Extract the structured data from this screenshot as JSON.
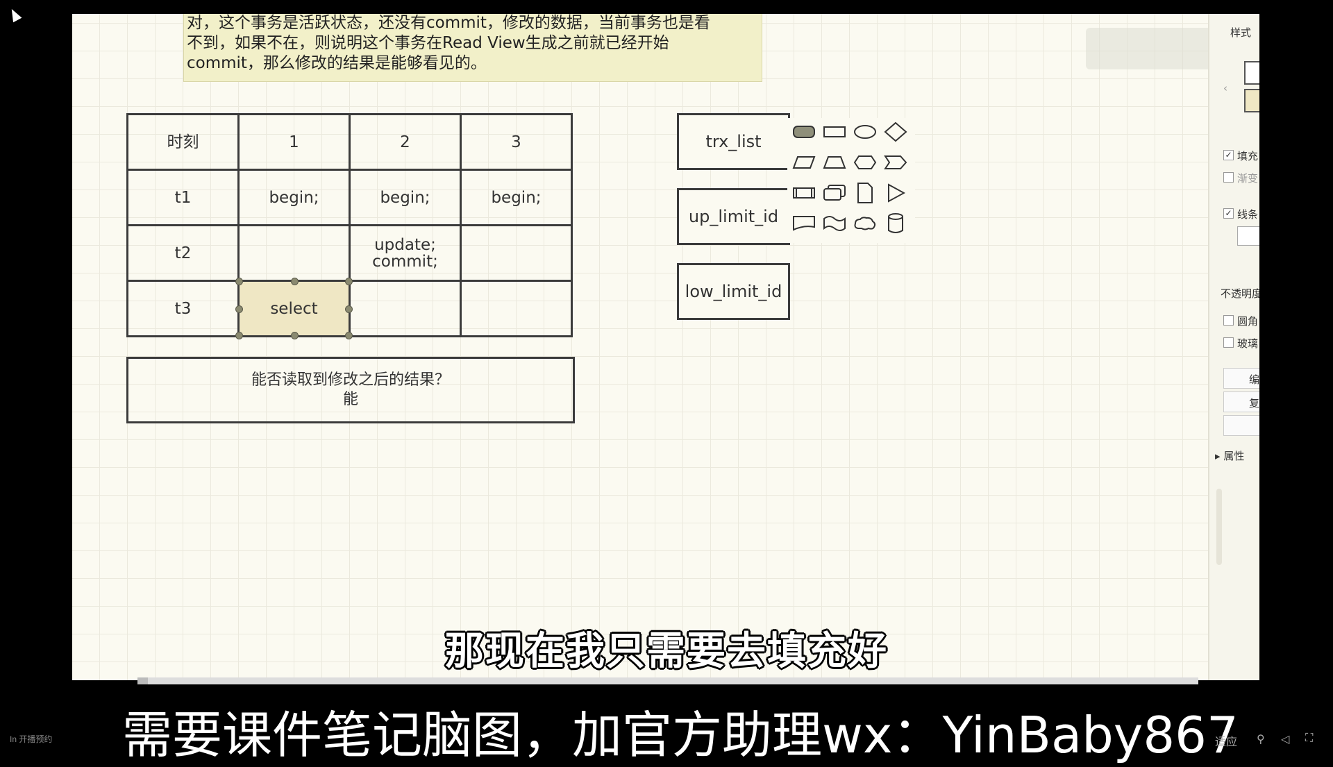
{
  "note": {
    "lines": [
      "对，这个事务是活跃状态，还没有commit，修改的数据，当前事务也是看",
      "不到，如果不在，则说明这个事务在Read View生成之前就已经开始",
      "commit，那么修改的结果是能够看见的。"
    ]
  },
  "table": {
    "header": [
      "时刻",
      "1",
      "2",
      "3"
    ],
    "rows": [
      [
        "t1",
        "begin;",
        "begin;",
        "begin;"
      ],
      [
        "t2",
        "",
        "update;\ncommit;",
        ""
      ],
      [
        "t3",
        "select",
        "",
        ""
      ]
    ]
  },
  "answer": {
    "question": "能否读取到修改之后的结果？",
    "result": "能"
  },
  "readview": {
    "trx_list": "trx_list",
    "up_limit_id": "up_limit_id",
    "low_limit_id": "low_limit_id"
  },
  "palette": {
    "shapes": [
      "rounded-rect-icon",
      "rectangle-icon",
      "ellipse-icon",
      "diamond-icon",
      "parallelogram-icon",
      "trapezoid-icon",
      "hexagon-icon",
      "tag-icon",
      "process-icon",
      "multi-doc-icon",
      "document-icon",
      "triangle-icon",
      "callout-icon",
      "wave-icon",
      "cloud-icon",
      "cylinder-icon"
    ]
  },
  "right_panel": {
    "title": "样式",
    "fill": "填充",
    "gradient": "渐变",
    "line": "线条",
    "opacity": "不透明度",
    "rounded": "圆角",
    "glass": "玻璃",
    "edit": "编",
    "copy": "复",
    "properties": "属性"
  },
  "subtitle": "那现在我只需要去填充好",
  "banner": "需要课件笔记脑图，加官方助理wx：YinBaby867",
  "progress": 0.01,
  "bottom_left": "In 开播预约",
  "bottom_right": "适应"
}
